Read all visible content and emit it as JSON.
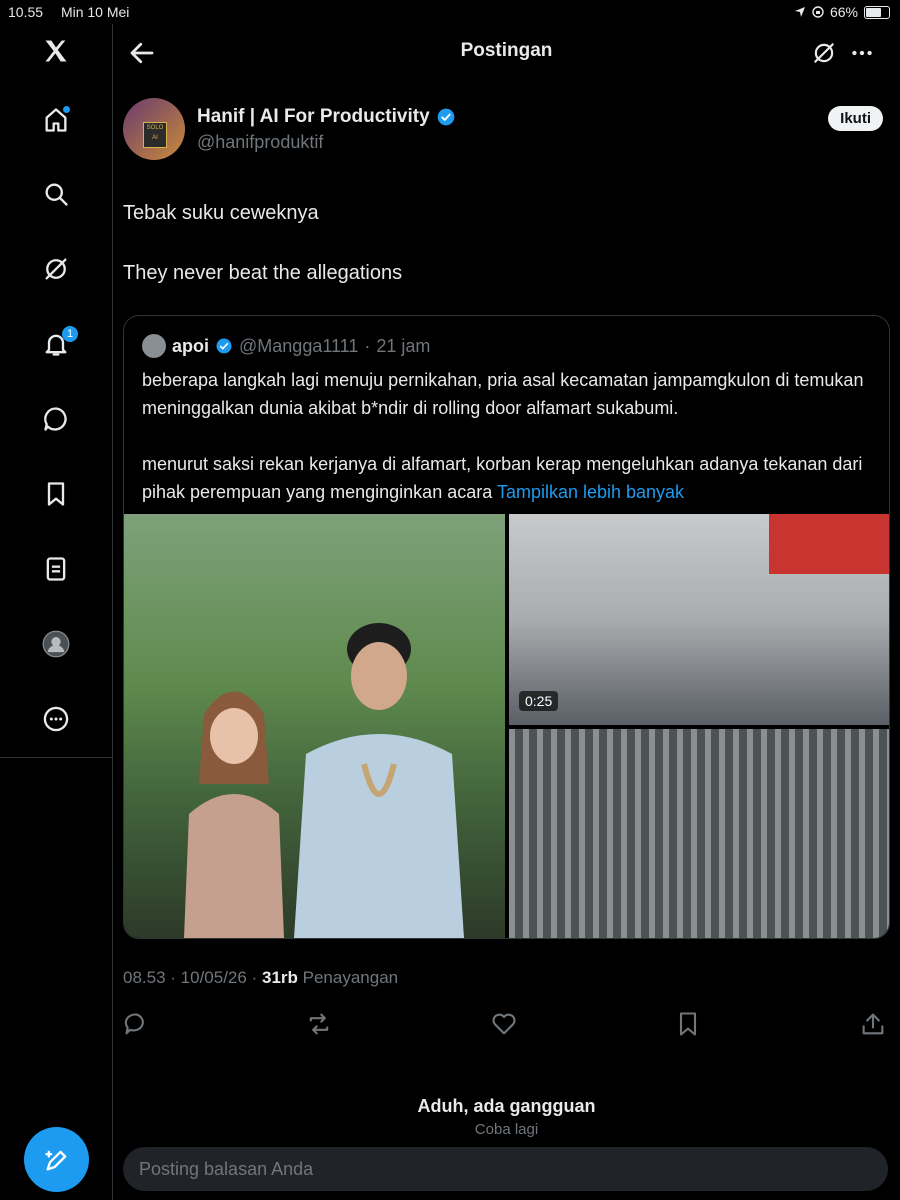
{
  "status_bar": {
    "time": "10.55",
    "date": "Min 10 Mei",
    "battery": "66%"
  },
  "header": {
    "title": "Postingan"
  },
  "author": {
    "name": "Hanif | AI For Productivity",
    "handle": "@hanifproduktif",
    "avatar_text": "SOLO AI"
  },
  "follow_label": "Ikuti",
  "nav_badges": {
    "notifications": "1"
  },
  "tweet": {
    "lines": [
      "Tebak suku ceweknya",
      "They never beat the allegations"
    ]
  },
  "quote": {
    "name": "apoi",
    "handle": "@Mangga1111",
    "time": "21 jam",
    "para1": "beberapa langkah lagi menuju pernikahan, pria asal kecamatan jampamgkulon di temukan meninggalkan dunia akibat b*ndir di rolling door alfamart sukabumi.",
    "para2": "menurut saksi rekan kerjanya di alfamart, korban kerap mengeluhkan adanya tekanan dari pihak perempuan yang menginginkan acara",
    "show_more": "Tampilkan lebih banyak",
    "video_duration": "0:25"
  },
  "stats": {
    "time": "08.53",
    "date": "10/05/26",
    "views": "31rb",
    "views_label": "Penayangan"
  },
  "error": {
    "title": "Aduh, ada gangguan",
    "retry": "Coba lagi"
  },
  "reply": {
    "placeholder": "Posting balasan Anda"
  },
  "colors": {
    "accent": "#1d9bf0",
    "background": "#000000",
    "muted": "#71767b"
  }
}
